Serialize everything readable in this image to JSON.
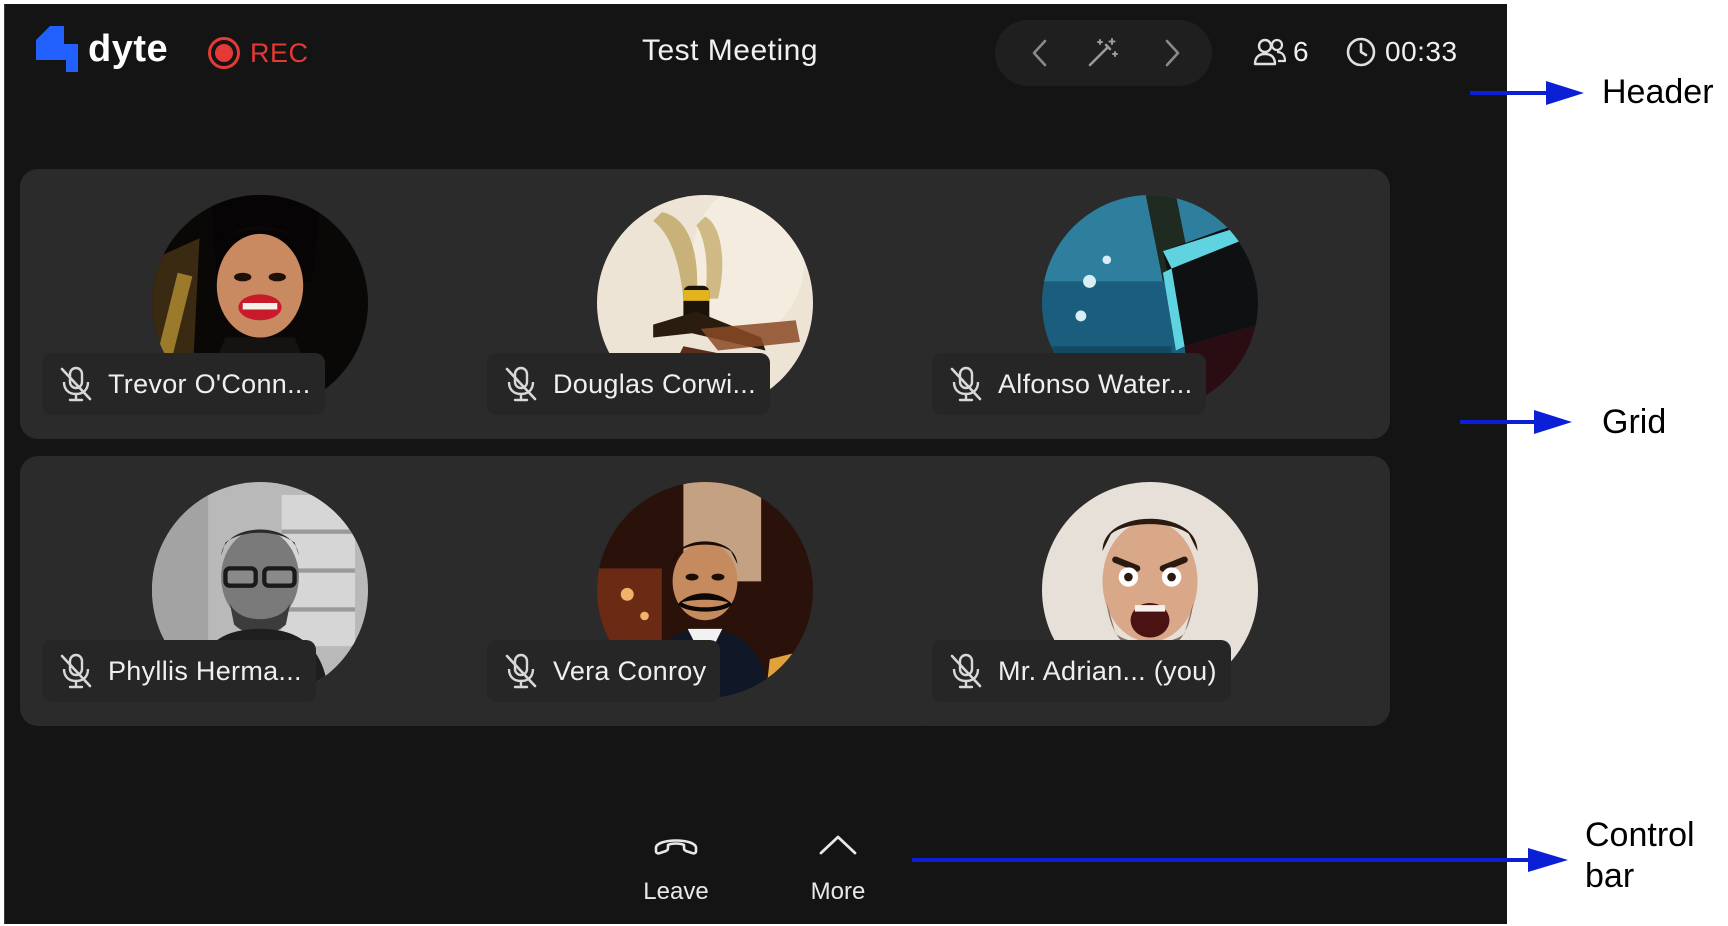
{
  "app": {
    "brand": "dyte",
    "recording_label": "REC",
    "meeting_title": "Test Meeting",
    "participant_count": "6",
    "elapsed_time": "00:33",
    "colors": {
      "brand_blue": "#2160fd",
      "rec_red": "#e53935",
      "background": "#141414",
      "tile": "#2b2b2b"
    }
  },
  "header": {
    "icons": [
      "chevron-left-icon",
      "magic-wand-icon",
      "chevron-right-icon",
      "participants-icon",
      "clock-icon"
    ]
  },
  "grid": {
    "tiles": [
      {
        "name": "Trevor O'Conn...",
        "mic": "muted"
      },
      {
        "name": "Douglas Corwi...",
        "mic": "muted"
      },
      {
        "name": "Alfonso Water...",
        "mic": "muted"
      },
      {
        "name": "Phyllis Herma...",
        "mic": "muted"
      },
      {
        "name": "Vera Conroy",
        "mic": "muted"
      },
      {
        "name": "Mr. Adrian... (you)",
        "mic": "muted"
      }
    ]
  },
  "controlbar": {
    "leave_label": "Leave",
    "more_label": "More"
  },
  "annotations": {
    "header": "Header",
    "grid": "Grid",
    "control_bar_line1": "Control",
    "control_bar_line2": "bar"
  }
}
